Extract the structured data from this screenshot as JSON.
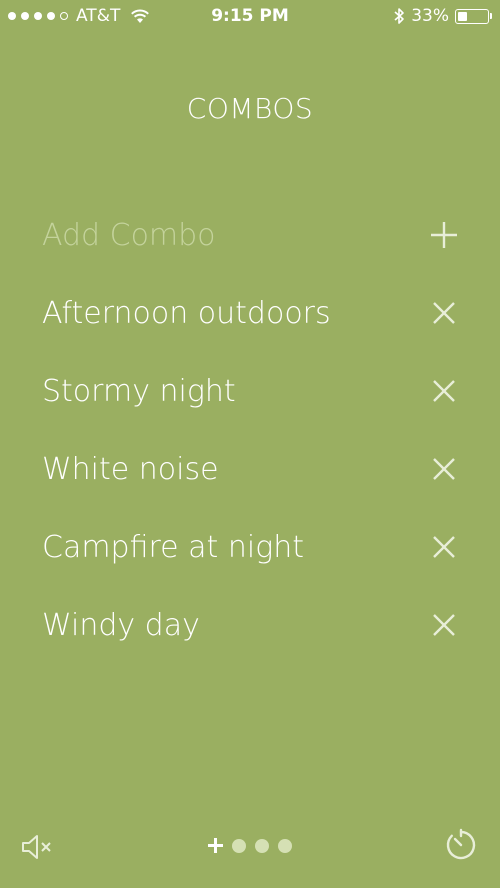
{
  "status_bar": {
    "carrier": "AT&T",
    "time": "9:15 PM",
    "battery_percent": "33%",
    "battery_level": 0.33,
    "signal_bars_filled": 4,
    "signal_bars_total": 5,
    "icons": [
      "wifi-icon",
      "bluetooth-icon",
      "battery-icon"
    ]
  },
  "header": {
    "title": "COMBOS"
  },
  "combos": {
    "add_label": "Add Combo",
    "add_icon": "plus-icon",
    "delete_icon": "close-icon",
    "items": [
      {
        "label": "Afternoon outdoors"
      },
      {
        "label": "Stormy night"
      },
      {
        "label": "White noise"
      },
      {
        "label": "Campfire at night"
      },
      {
        "label": "Windy day"
      }
    ]
  },
  "bottom_bar": {
    "left_icon": "mute-icon",
    "right_icon": "timer-icon",
    "page_indicator": {
      "first": "plus-icon",
      "dots": 3
    }
  },
  "colors": {
    "background": "#9aaf61",
    "text": "#ffffff",
    "muted_text": "#c4d39c",
    "icon": "#e8eed8"
  }
}
